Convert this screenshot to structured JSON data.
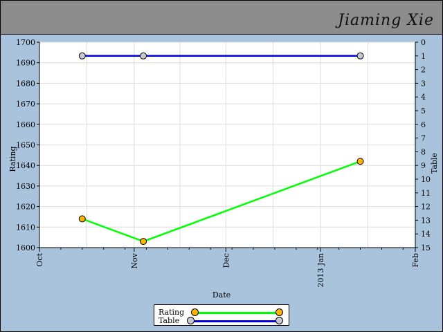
{
  "header": {
    "author": "Jiaming Xie",
    "background": "#8c8c8c"
  },
  "chart_data": {
    "type": "line",
    "title": "",
    "xlabel": "Date",
    "ylabel_left": "Rating",
    "ylabel_right": "Table",
    "x_ticks": [
      {
        "label": "Oct",
        "date": "2012-10-01"
      },
      {
        "label": "Nov",
        "date": "2012-11-01"
      },
      {
        "label": "Dec",
        "date": "2012-12-01"
      },
      {
        "label": "2013 Jan",
        "date": "2013-01-01"
      },
      {
        "label": "Feb",
        "date": "2013-02-01"
      }
    ],
    "xlim": [
      "2012-10-01",
      "2013-02-01"
    ],
    "ylim_left": [
      1600,
      1700
    ],
    "yticks_left": [
      1600,
      1610,
      1620,
      1630,
      1640,
      1650,
      1660,
      1670,
      1680,
      1690,
      1700
    ],
    "ylim_right": [
      15,
      0
    ],
    "yticks_right": [
      0,
      1,
      2,
      3,
      4,
      5,
      6,
      7,
      8,
      9,
      10,
      11,
      12,
      13,
      14,
      15
    ],
    "grid": true,
    "legend_position": "bottom-center",
    "series": [
      {
        "name": "Rating",
        "axis": "left",
        "color": "#00ff00",
        "marker_color": "#ffb300",
        "points": [
          {
            "x": "2012-10-15",
            "y": 1614
          },
          {
            "x": "2012-11-04",
            "y": 1603
          },
          {
            "x": "2013-01-14",
            "y": 1642
          }
        ]
      },
      {
        "name": "Table",
        "axis": "right",
        "color": "#0000dd",
        "marker_color": "#c8c8d0",
        "points": [
          {
            "x": "2012-10-15",
            "y": 1
          },
          {
            "x": "2012-11-04",
            "y": 1
          },
          {
            "x": "2013-01-14",
            "y": 1
          }
        ]
      }
    ]
  }
}
